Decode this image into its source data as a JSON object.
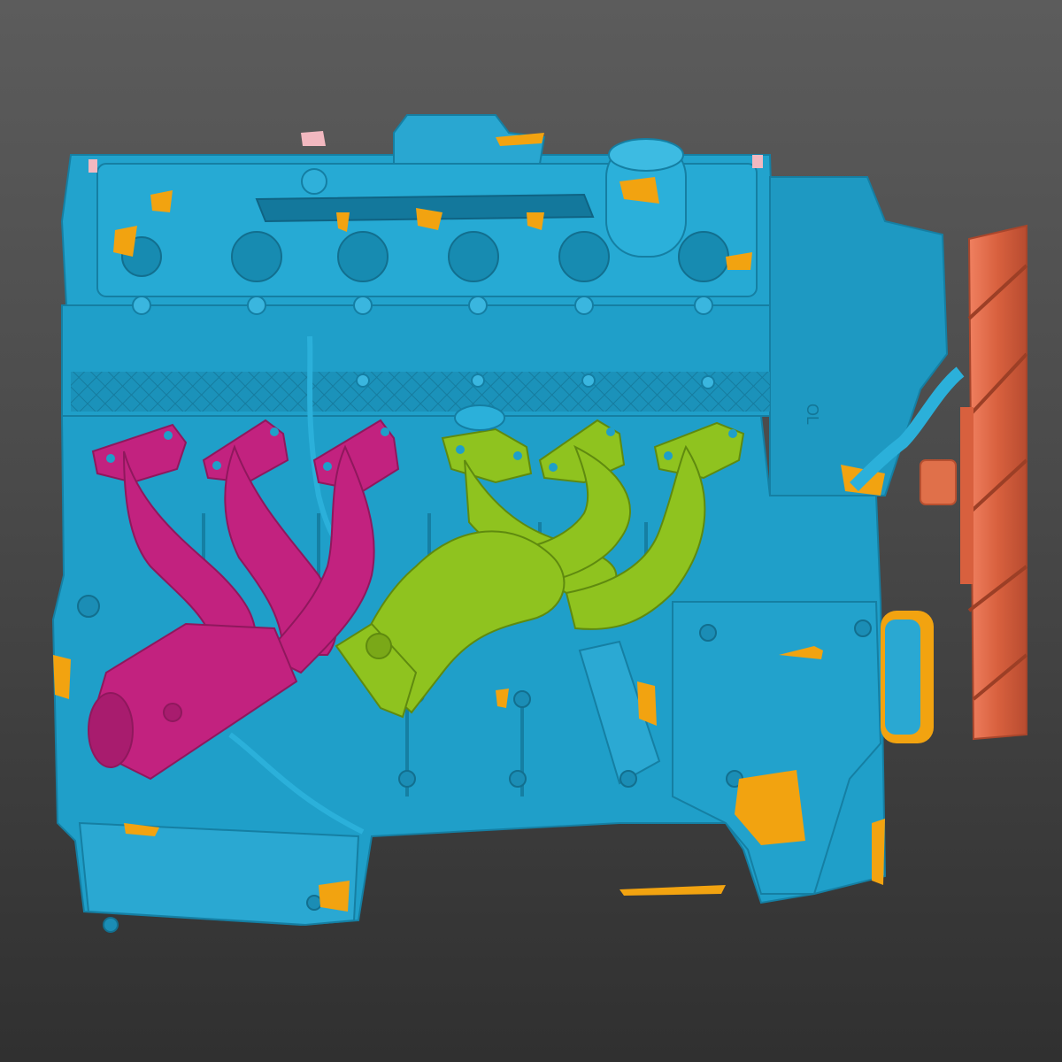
{
  "viewport": {
    "background_top": "#5c5c5c",
    "background_bottom": "#303030"
  },
  "model": {
    "parts": [
      {
        "name": "engine-block",
        "color": "#1f9fc9"
      },
      {
        "name": "exhaust-header-front",
        "color": "#c2227f"
      },
      {
        "name": "exhaust-header-rear",
        "color": "#8fc31f"
      },
      {
        "name": "cooling-fan",
        "color": "#e0704a"
      },
      {
        "name": "backface-highlights",
        "color": "#f2a310"
      },
      {
        "name": "oil-filler-cap-area",
        "color": "#f2b8c0"
      }
    ],
    "valve_cover_stamp": "OL"
  }
}
